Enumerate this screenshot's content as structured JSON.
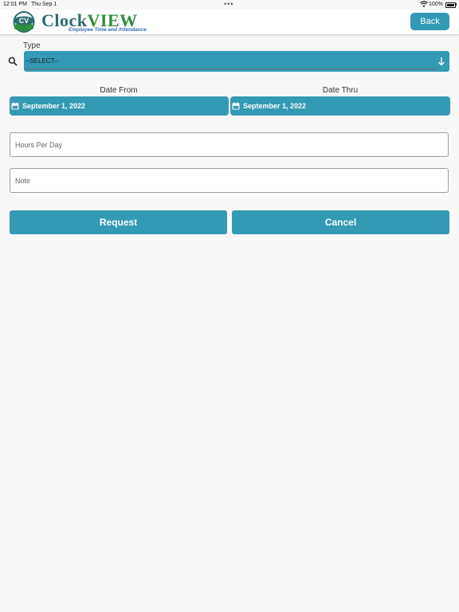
{
  "status_bar": {
    "time": "12:01 PM",
    "date": "Thu Sep 1",
    "battery": "100%"
  },
  "header": {
    "logo_badge": "CV",
    "logo_word_1": "Clock",
    "logo_word_2": "VIEW",
    "logo_tagline": "Employee Time and Attendance",
    "back_label": "Back"
  },
  "form": {
    "type_label": "Type",
    "type_selected": "--SELECT--",
    "date_from_label": "Date From",
    "date_from_value": "September 1, 2022",
    "date_thru_label": "Date Thru",
    "date_thru_value": "September 1, 2022",
    "hours_placeholder": "Hours Per Day",
    "note_placeholder": "Note",
    "request_label": "Request",
    "cancel_label": "Cancel"
  },
  "icons": [
    "search-icon",
    "arrow-down-icon",
    "calendar-icon",
    "wifi-icon",
    "battery-icon"
  ],
  "colors": {
    "accent": "#3399b5",
    "logo_teal": "#2b6c6f",
    "logo_green": "#2f8f3a",
    "tagline_blue": "#2e6fb5",
    "background": "#f8f8f8"
  }
}
